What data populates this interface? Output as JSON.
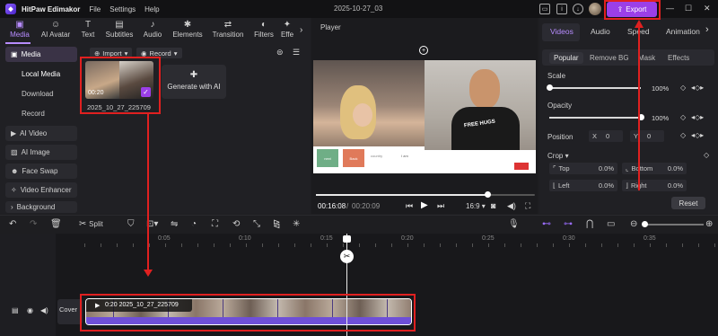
{
  "app": {
    "name": "HitPaw Edimakor",
    "menus": [
      "File",
      "Settings",
      "Help"
    ],
    "project_title": "2025-10-27_03",
    "export_label": "Export"
  },
  "top_tabs": [
    {
      "label": "Media",
      "icon": "media-icon"
    },
    {
      "label": "AI Avatar",
      "icon": "ai-avatar-icon"
    },
    {
      "label": "Text",
      "icon": "text-icon"
    },
    {
      "label": "Subtitles",
      "icon": "subtitles-icon"
    },
    {
      "label": "Audio",
      "icon": "audio-icon"
    },
    {
      "label": "Elements",
      "icon": "elements-icon"
    },
    {
      "label": "Transition",
      "icon": "transition-icon"
    },
    {
      "label": "Filters",
      "icon": "filters-icon"
    },
    {
      "label": "Effe",
      "icon": "effects-icon"
    }
  ],
  "sidebar": {
    "items": [
      {
        "label": "Media",
        "type": "section"
      },
      {
        "label": "Local Media",
        "type": "sub"
      },
      {
        "label": "Download",
        "type": "sub"
      },
      {
        "label": "Record",
        "type": "sub"
      },
      {
        "label": "AI Video",
        "type": "section"
      },
      {
        "label": "AI Image",
        "type": "section"
      },
      {
        "label": "Face Swap",
        "type": "section"
      },
      {
        "label": "Video Enhancer",
        "type": "section"
      },
      {
        "label": "Background",
        "type": "section"
      }
    ]
  },
  "media": {
    "import_label": "Import",
    "record_label": "Record",
    "clip_name": "2025_10_27_225709",
    "clip_duration": "00:20",
    "generate_ai_label": "Generate with AI"
  },
  "player": {
    "title": "Player",
    "current_time": "00:16:08",
    "total_time": "00:20:09",
    "aspect": "16:9",
    "progress": 0.78
  },
  "video_overlay": {
    "buttons": [
      "next",
      "Back",
      "country"
    ],
    "card_text": "I am",
    "shirt_text": "FREE HUGS"
  },
  "right": {
    "tabs": [
      "Videos",
      "Audio",
      "Speed",
      "Animation"
    ],
    "subtabs": [
      "Popular",
      "Remove BG",
      "Mask",
      "Effects"
    ],
    "scale_label": "Scale",
    "scale_value": "100%",
    "scale_level": 0.0,
    "opacity_label": "Opacity",
    "opacity_value": "100%",
    "opacity_level": 1.0,
    "position_label": "Position",
    "x_label": "X",
    "x_value": "0",
    "y_label": "Y",
    "y_value": "0",
    "crop_label": "Crop",
    "crop": [
      {
        "label": "Top",
        "value": "0.0%"
      },
      {
        "label": "Bottom",
        "value": "0.0%"
      },
      {
        "label": "Left",
        "value": "0.0%"
      },
      {
        "label": "Right",
        "value": "0.0%"
      }
    ],
    "reset_label": "Reset"
  },
  "toolbar": {
    "split_label": "Split"
  },
  "timeline": {
    "ruler": [
      "0:05",
      "0:10",
      "0:15",
      "0:20",
      "0:25",
      "0:30",
      "0:35"
    ],
    "cover_label": "Cover",
    "clip_label": "0:20  2025_10_27_225709"
  },
  "colors": {
    "accent": "#9b3fe8",
    "highlight": "#e02020"
  }
}
